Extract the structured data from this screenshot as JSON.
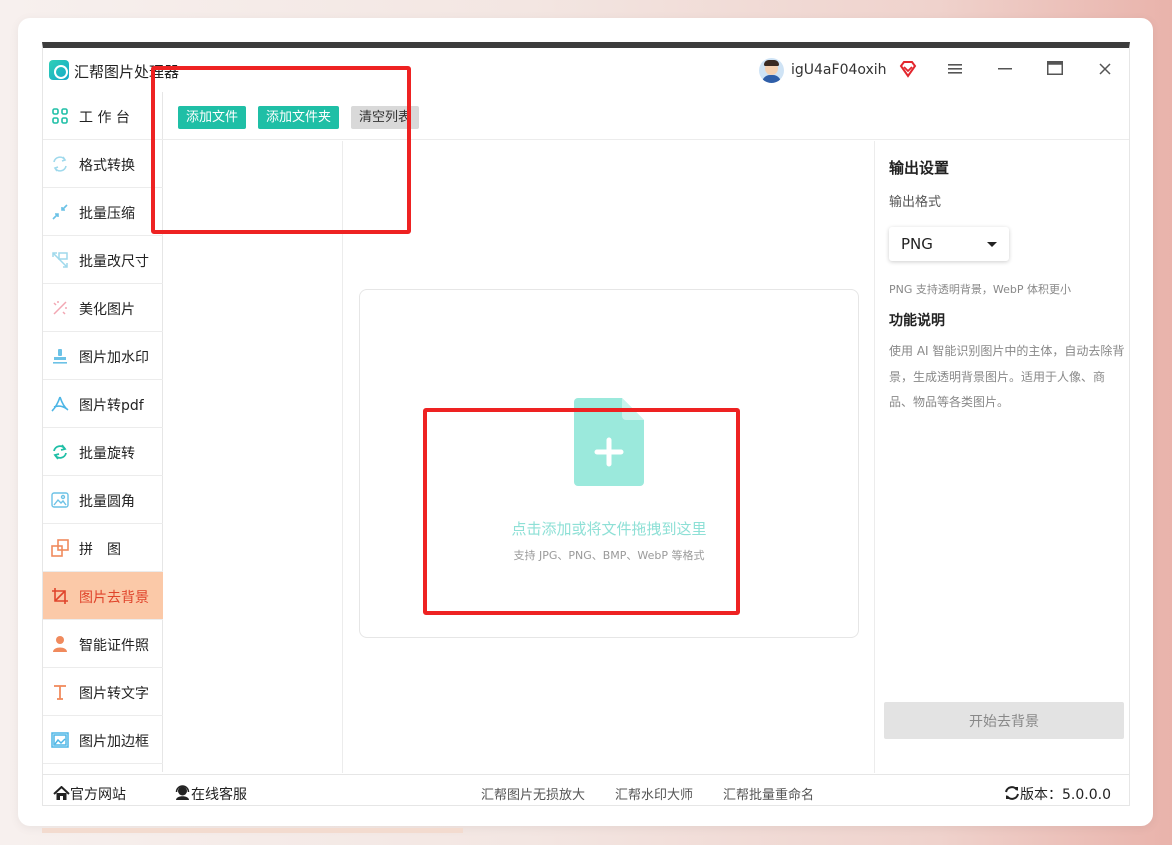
{
  "app": {
    "title": "汇帮图片处理器"
  },
  "user": {
    "name": "igU4aF04oxih"
  },
  "toolbar": {
    "add_file": "添加文件",
    "add_folder": "添加文件夹",
    "clear_list": "清空列表"
  },
  "sidebar": {
    "items": [
      {
        "label": "工 作 台",
        "icon": "grid-icon"
      },
      {
        "label": "格式转换",
        "icon": "convert-icon"
      },
      {
        "label": "批量压缩",
        "icon": "compress-icon"
      },
      {
        "label": "批量改尺寸",
        "icon": "resize-icon"
      },
      {
        "label": "美化图片",
        "icon": "beautify-icon"
      },
      {
        "label": "图片加水印",
        "icon": "watermark-icon"
      },
      {
        "label": "图片转pdf",
        "icon": "pdf-icon"
      },
      {
        "label": "批量旋转",
        "icon": "rotate-icon"
      },
      {
        "label": "批量圆角",
        "icon": "round-corner-icon"
      },
      {
        "label": "拼　图",
        "icon": "collage-icon"
      },
      {
        "label": "图片去背景",
        "icon": "crop-icon"
      },
      {
        "label": "智能证件照",
        "icon": "person-icon"
      },
      {
        "label": "图片转文字",
        "icon": "text-icon"
      },
      {
        "label": "图片加边框",
        "icon": "frame-icon"
      }
    ],
    "active_index": 10
  },
  "dropzone": {
    "main_text": "点击添加或将文件拖拽到这里",
    "sub_text": "支持 JPG、PNG、BMP、WebP 等格式"
  },
  "output": {
    "title": "输出设置",
    "format_label": "输出格式",
    "format_value": "PNG",
    "format_hint": "PNG 支持透明背景，WebP 体积更小",
    "func_title": "功能说明",
    "func_desc": "使用 AI 智能识别图片中的主体，自动去除背景，生成透明背景图片。适用于人像、商品、物品等各类图片。",
    "start_button": "开始去背景"
  },
  "footer": {
    "website": "官方网站",
    "service": "在线客服",
    "links": [
      "汇帮图片无损放大",
      "汇帮水印大师",
      "汇帮批量重命名"
    ],
    "version": "版本：5.0.0.0"
  },
  "colors": {
    "accent": "#1fbfa6",
    "active_bg": "#fbc9a8",
    "active_text": "#e0442b",
    "annotation": "#ee2222"
  }
}
